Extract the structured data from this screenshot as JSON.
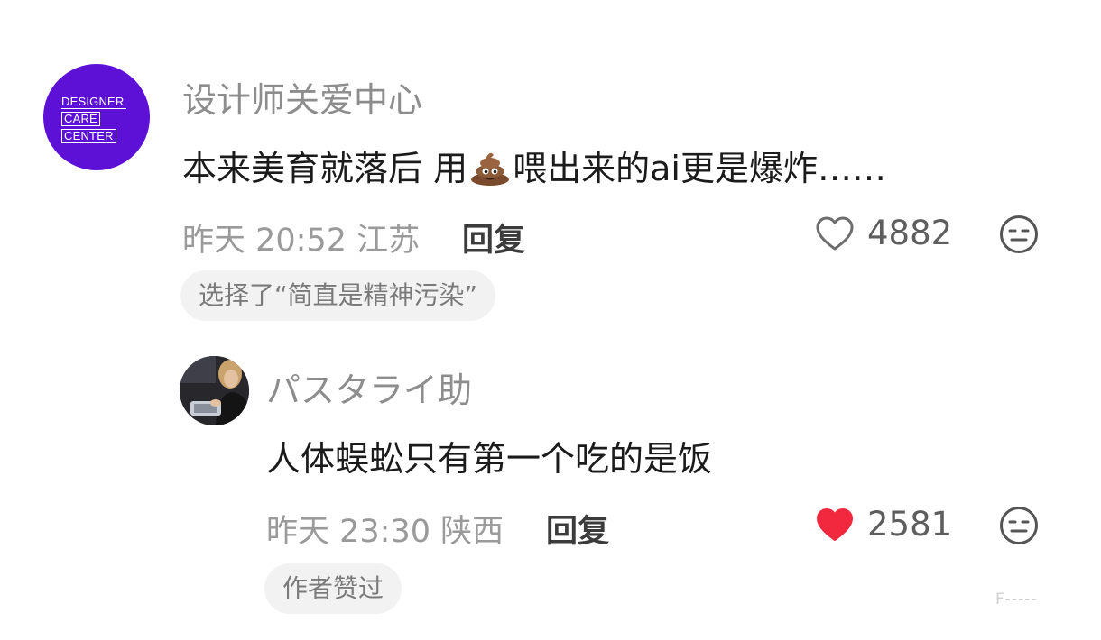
{
  "comments": [
    {
      "username": "设计师关爱中心",
      "avatar_text": [
        "DESIGNER",
        "CARE",
        "CENTER"
      ],
      "avatar_color": "#5d11d6",
      "text_before": "本来美育就落后 用",
      "emoji_icon": "poop-emoji-icon",
      "text_after": "喂出来的ai更是爆炸……",
      "time": "昨天 20:52",
      "location": "江苏",
      "reply_label": "回复",
      "likes": "4882",
      "liked": false,
      "chip": "选择了“简直是精神污染”"
    },
    {
      "username": "パスタライ助",
      "text": "人体蜈蚣只有第一个吃的是饭",
      "time": "昨天 23:30",
      "location": "陕西",
      "reply_label": "回复",
      "likes": "2581",
      "liked": true,
      "like_color": "#f2283f",
      "chip": "作者赞过"
    }
  ],
  "watermark": "F-----"
}
